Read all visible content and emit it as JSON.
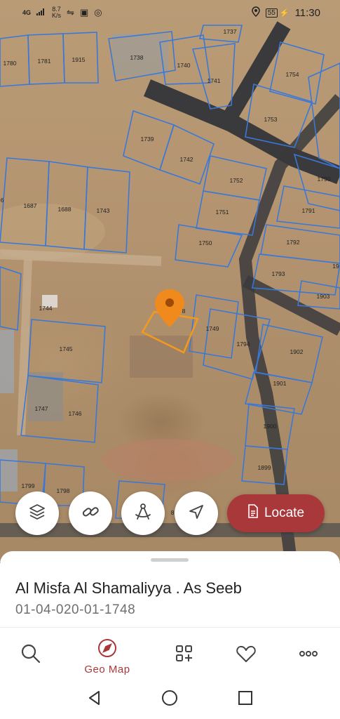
{
  "status_bar": {
    "network": "4G",
    "speed_value": "8.7",
    "speed_unit": "K/s",
    "battery": "55",
    "time": "11:30"
  },
  "map": {
    "parcels": [
      {
        "label": "1737"
      },
      {
        "label": "1780"
      },
      {
        "label": "1781"
      },
      {
        "label": "1915"
      },
      {
        "label": "1738"
      },
      {
        "label": "1740"
      },
      {
        "label": "1741"
      },
      {
        "label": "1754"
      },
      {
        "label": "1753"
      },
      {
        "label": "1739"
      },
      {
        "label": "1742"
      },
      {
        "label": "1790"
      },
      {
        "label": "1752"
      },
      {
        "label": "1687"
      },
      {
        "label": "1688"
      },
      {
        "label": "1743"
      },
      {
        "label": "1751"
      },
      {
        "label": "1791"
      },
      {
        "label": "1750"
      },
      {
        "label": "1792"
      },
      {
        "label": "1793"
      },
      {
        "label": "19"
      },
      {
        "label": "1903"
      },
      {
        "label": "1744"
      },
      {
        "label": "1749"
      },
      {
        "label": "1745"
      },
      {
        "label": "1794"
      },
      {
        "label": "1902"
      },
      {
        "label": "1901"
      },
      {
        "label": "1747"
      },
      {
        "label": "1746"
      },
      {
        "label": "1900"
      },
      {
        "label": "1899"
      },
      {
        "label": "1799"
      },
      {
        "label": "1798"
      },
      {
        "label": "8"
      },
      {
        "label": "6"
      },
      {
        "label": "8"
      }
    ],
    "marker_color": "#f08a1c",
    "parcel_line_color": "#3a78d8",
    "road_color": "#3b3b3d"
  },
  "actions": {
    "locate_label": "Locate"
  },
  "sheet": {
    "place_name": "Al Misfa Al Shamaliyya . As Seeb",
    "parcel_code": "01-04-020-01-1748"
  },
  "tabs": [
    {
      "label": "",
      "icon": "search-icon"
    },
    {
      "label": "Geo Map",
      "icon": "compass-icon",
      "active": true
    },
    {
      "label": "",
      "icon": "apps-add-icon"
    },
    {
      "label": "",
      "icon": "heart-icon"
    },
    {
      "label": "",
      "icon": "more-icon"
    }
  ],
  "colors": {
    "accent": "#a8383a"
  }
}
